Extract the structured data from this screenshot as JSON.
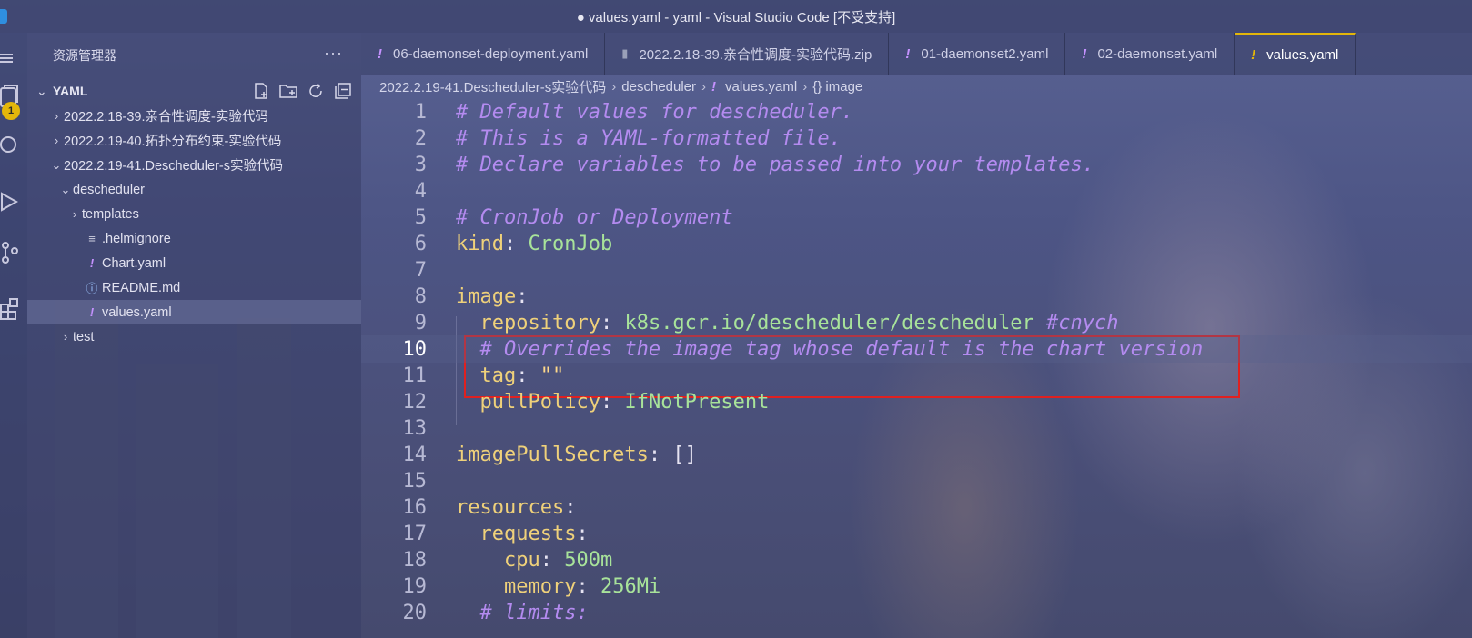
{
  "window": {
    "title": "● values.yaml - yaml - Visual Studio Code [不受支持]"
  },
  "activity_badge": "1",
  "sidebar": {
    "header": "资源管理器",
    "more": "···",
    "section": "YAML",
    "tree": [
      {
        "label": "2022.2.18-39.亲合性调度-实验代码",
        "indent": 0,
        "twisty": "›",
        "icon": ""
      },
      {
        "label": "2022.2.19-40.拓扑分布约束-实验代码",
        "indent": 0,
        "twisty": "›",
        "icon": ""
      },
      {
        "label": "2022.2.19-41.Descheduler-s实验代码",
        "indent": 0,
        "twisty": "⌄",
        "icon": ""
      },
      {
        "label": "descheduler",
        "indent": 1,
        "twisty": "⌄",
        "icon": ""
      },
      {
        "label": "templates",
        "indent": 2,
        "twisty": "›",
        "icon": ""
      },
      {
        "label": ".helmignore",
        "indent": 2,
        "twisty": "",
        "icon": "≡"
      },
      {
        "label": "Chart.yaml",
        "indent": 2,
        "twisty": "",
        "icon": "!"
      },
      {
        "label": "README.md",
        "indent": 2,
        "twisty": "",
        "icon": "ⓘ"
      },
      {
        "label": "values.yaml",
        "indent": 2,
        "twisty": "",
        "icon": "!"
      },
      {
        "label": "test",
        "indent": 1,
        "twisty": "›",
        "icon": ""
      }
    ]
  },
  "tabs": [
    {
      "label": "06-daemonset-deployment.yaml",
      "icon": "!"
    },
    {
      "label": "2022.2.18-39.亲合性调度-实验代码.zip",
      "icon": "▮"
    },
    {
      "label": "01-daemonset2.yaml",
      "icon": "!"
    },
    {
      "label": "02-daemonset.yaml",
      "icon": "!"
    },
    {
      "label": "values.yaml",
      "icon": "!"
    }
  ],
  "breadcrumb": {
    "folder": "2022.2.19-41.Descheduler-s实验代码",
    "subfolder": "descheduler",
    "file_icon": "!",
    "file": "values.yaml",
    "symbol": "{} image"
  },
  "editor": {
    "current_line": 10,
    "lines": [
      {
        "n": "1",
        "segs": [
          [
            "c-comment",
            "# Default values for descheduler."
          ]
        ]
      },
      {
        "n": "2",
        "segs": [
          [
            "c-comment",
            "# This is a YAML-formatted file."
          ]
        ]
      },
      {
        "n": "3",
        "segs": [
          [
            "c-comment",
            "# Declare variables to be passed into your templates."
          ]
        ]
      },
      {
        "n": "4",
        "segs": []
      },
      {
        "n": "5",
        "segs": [
          [
            "c-comment",
            "# CronJob or Deployment"
          ]
        ]
      },
      {
        "n": "6",
        "segs": [
          [
            "c-key",
            "kind"
          ],
          [
            "c-punct",
            ": "
          ],
          [
            "c-val",
            "CronJob"
          ]
        ]
      },
      {
        "n": "7",
        "segs": []
      },
      {
        "n": "8",
        "segs": [
          [
            "c-key",
            "image"
          ],
          [
            "c-punct",
            ":"
          ]
        ]
      },
      {
        "n": "9",
        "segs": [
          [
            "c-punct",
            "  "
          ],
          [
            "c-key",
            "repository"
          ],
          [
            "c-punct",
            ": "
          ],
          [
            "c-val",
            "k8s.gcr.io/descheduler/descheduler "
          ],
          [
            "c-comment",
            "#cnych"
          ]
        ]
      },
      {
        "n": "10",
        "segs": [
          [
            "c-punct",
            "  "
          ],
          [
            "c-comment",
            "# Overrides the image tag whose default is the chart version"
          ]
        ]
      },
      {
        "n": "11",
        "segs": [
          [
            "c-punct",
            "  "
          ],
          [
            "c-key",
            "tag"
          ],
          [
            "c-punct",
            ": "
          ],
          [
            "c-str",
            "\"\""
          ]
        ]
      },
      {
        "n": "12",
        "segs": [
          [
            "c-punct",
            "  "
          ],
          [
            "c-key",
            "pullPolicy"
          ],
          [
            "c-punct",
            ": "
          ],
          [
            "c-val",
            "IfNotPresent"
          ]
        ]
      },
      {
        "n": "13",
        "segs": []
      },
      {
        "n": "14",
        "segs": [
          [
            "c-key",
            "imagePullSecrets"
          ],
          [
            "c-punct",
            ": []"
          ]
        ]
      },
      {
        "n": "15",
        "segs": []
      },
      {
        "n": "16",
        "segs": [
          [
            "c-key",
            "resources"
          ],
          [
            "c-punct",
            ":"
          ]
        ]
      },
      {
        "n": "17",
        "segs": [
          [
            "c-punct",
            "  "
          ],
          [
            "c-key",
            "requests"
          ],
          [
            "c-punct",
            ":"
          ]
        ]
      },
      {
        "n": "18",
        "segs": [
          [
            "c-punct",
            "    "
          ],
          [
            "c-key",
            "cpu"
          ],
          [
            "c-punct",
            ": "
          ],
          [
            "c-val",
            "500m"
          ]
        ]
      },
      {
        "n": "19",
        "segs": [
          [
            "c-punct",
            "    "
          ],
          [
            "c-key",
            "memory"
          ],
          [
            "c-punct",
            ": "
          ],
          [
            "c-val",
            "256Mi"
          ]
        ]
      },
      {
        "n": "20",
        "segs": [
          [
            "c-punct",
            "  "
          ],
          [
            "c-comment",
            "# limits:"
          ]
        ]
      }
    ]
  }
}
